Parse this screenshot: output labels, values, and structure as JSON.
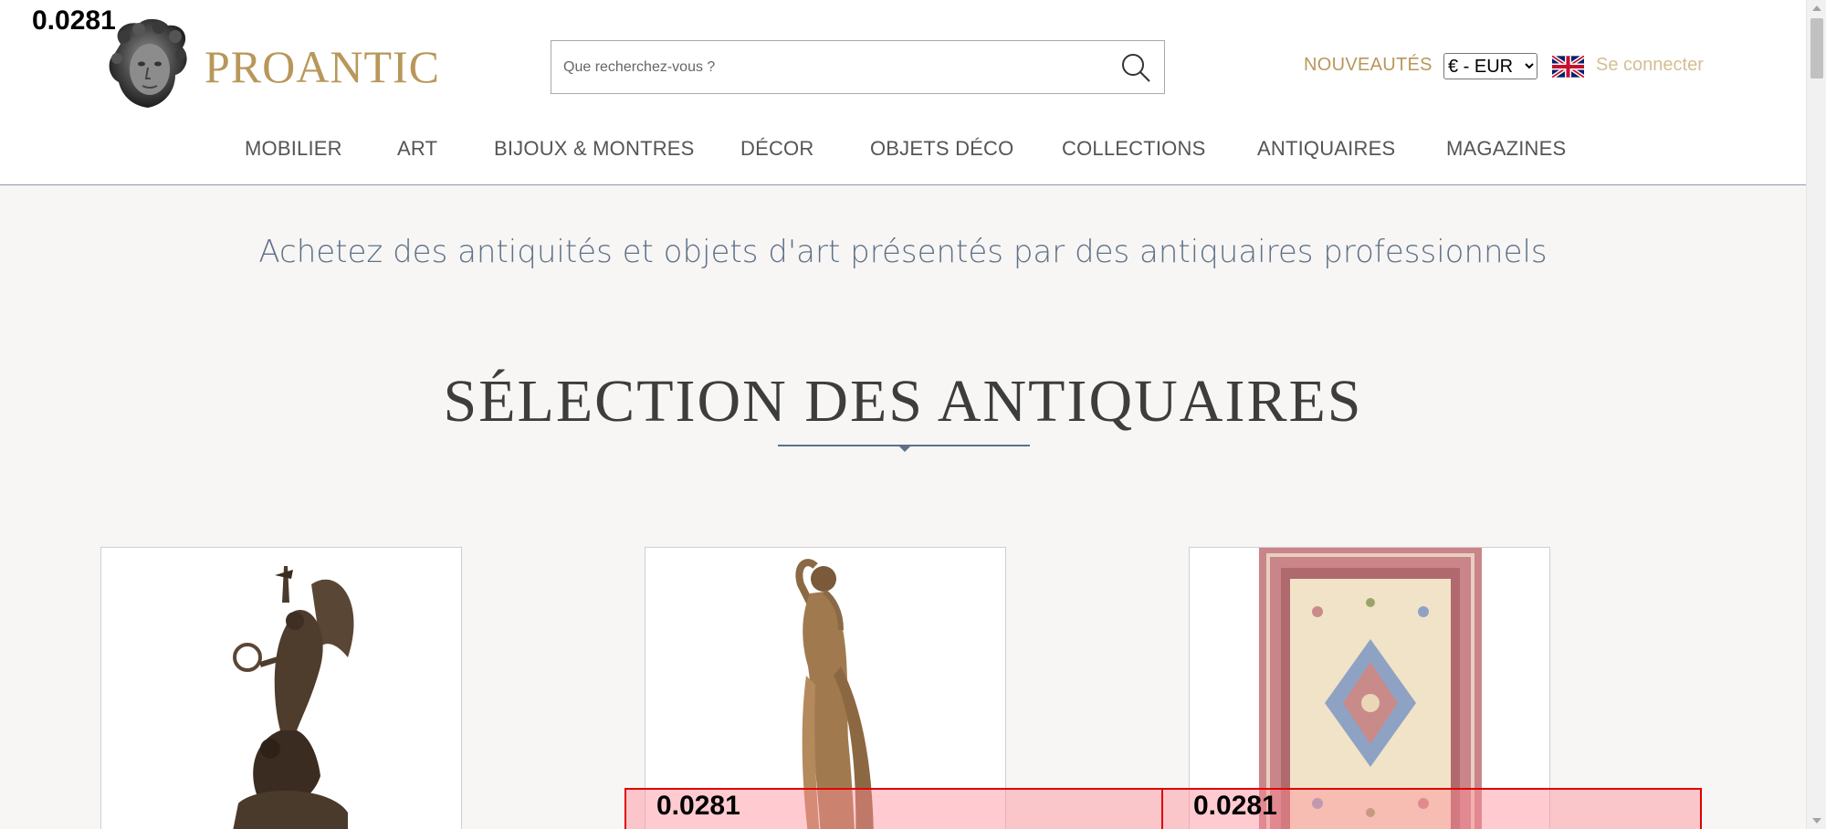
{
  "header": {
    "logo_text": "PROANTIC",
    "search": {
      "placeholder": "Que recherchez-vous ?"
    },
    "nouveautes_label": "NOUVEAUTÉS",
    "currency": {
      "selected": "€ - EUR"
    },
    "flag_icon": "uk-flag-icon",
    "connect_label": "Se connecter"
  },
  "nav": {
    "items": [
      {
        "label": "MOBILIER"
      },
      {
        "label": "ART"
      },
      {
        "label": "BIJOUX & MONTRES"
      },
      {
        "label": "DÉCOR"
      },
      {
        "label": "OBJETS DÉCO"
      },
      {
        "label": "COLLECTIONS"
      },
      {
        "label": "ANTIQUAIRES"
      },
      {
        "label": "MAGAZINES"
      }
    ]
  },
  "main": {
    "tagline": "Achetez des antiquités et objets d'art présentés par des antiquaires professionnels",
    "section_title": "SÉLECTION DES ANTIQUAIRES"
  },
  "overlay": {
    "top_left_score": "0.0281",
    "bar_scores": [
      "0.0281",
      "0.0281"
    ]
  },
  "colors": {
    "brand_gold": "#b8975a",
    "accent_blue": "#5f7189",
    "overlay_red": "#e10000"
  }
}
